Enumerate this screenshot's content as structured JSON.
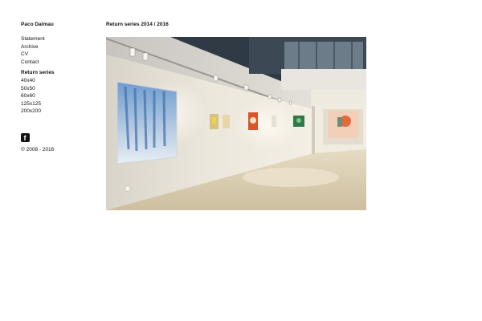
{
  "site": {
    "title": "Paco Dalmau"
  },
  "nav": {
    "main_items": [
      {
        "label": "Statement"
      },
      {
        "label": "Archive"
      },
      {
        "label": "CV"
      },
      {
        "label": "Contact"
      }
    ],
    "series_heading": "Return series",
    "series_items": [
      {
        "label": "40x40"
      },
      {
        "label": "50x50"
      },
      {
        "label": "60x60"
      },
      {
        "label": "125x125"
      },
      {
        "label": "200x200"
      }
    ]
  },
  "social": {
    "facebook_glyph": "f",
    "icon": "facebook-icon"
  },
  "footer": {
    "copyright": "© 2008 - 2016"
  },
  "main": {
    "heading": "Return series 2014 / 2016"
  },
  "colors": {
    "text": "#111111",
    "background": "#ffffff"
  }
}
